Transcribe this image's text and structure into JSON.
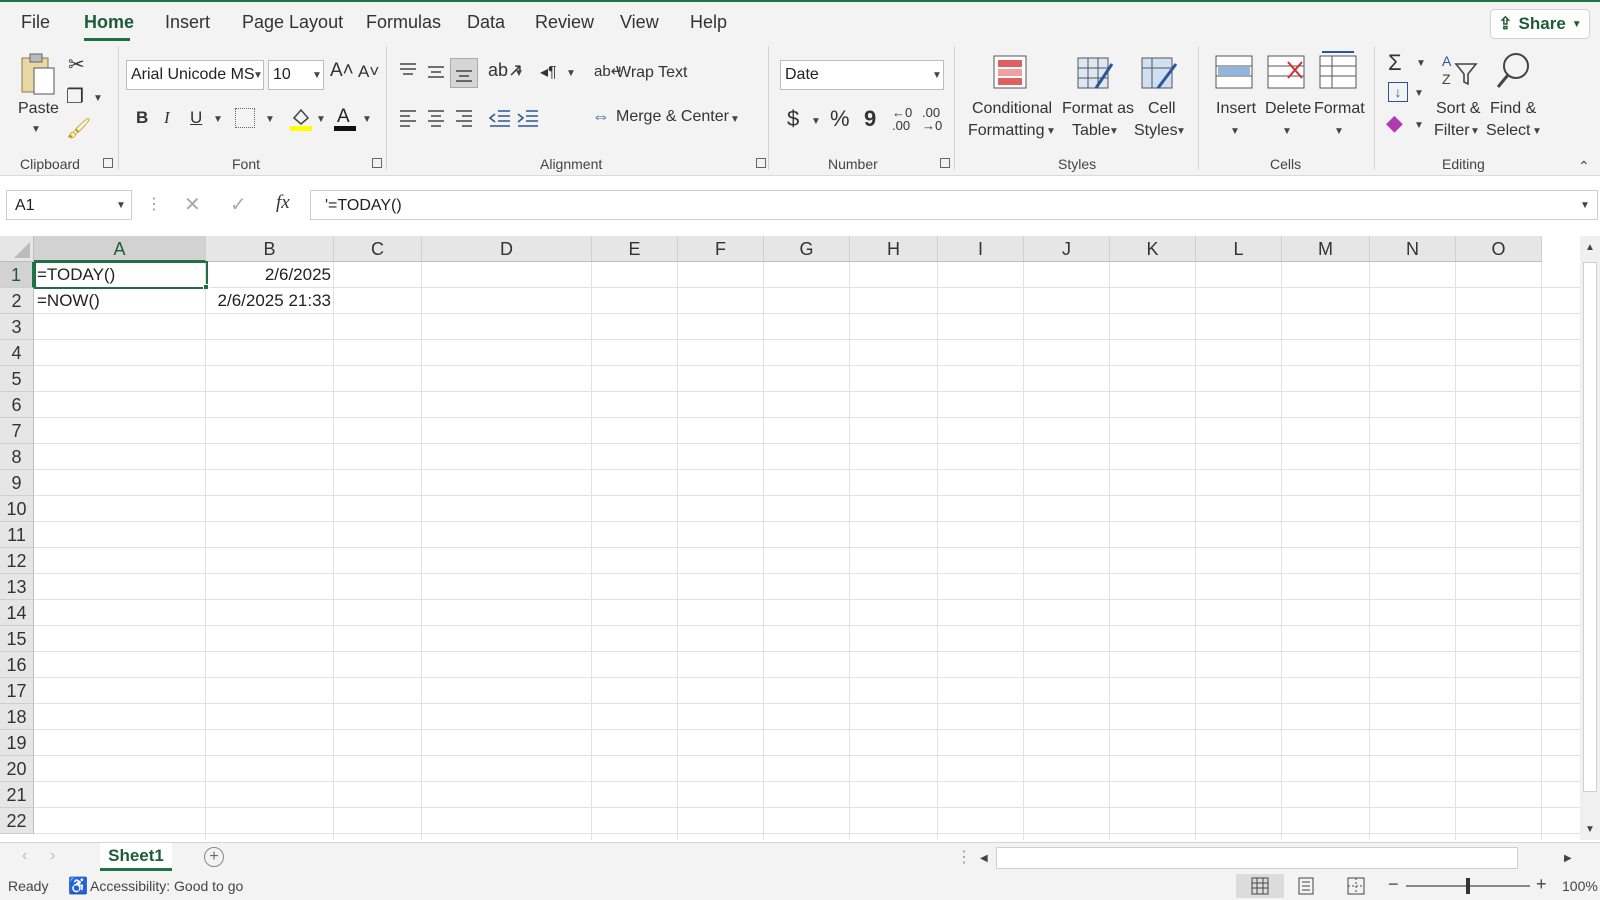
{
  "ribbon_tabs": [
    "File",
    "Home",
    "Insert",
    "Page Layout",
    "Formulas",
    "Data",
    "Review",
    "View",
    "Help"
  ],
  "share_label": "Share",
  "clipboard": {
    "paste": "Paste",
    "group": "Clipboard"
  },
  "font": {
    "name": "Arial Unicode MS",
    "size": "10",
    "group": "Font",
    "bold": "B",
    "italic": "I",
    "underline": "U"
  },
  "alignment": {
    "wrap_text": "Wrap Text",
    "merge_center": "Merge & Center",
    "group": "Alignment"
  },
  "number": {
    "format": "Date",
    "group": "Number",
    "currency": "$",
    "percent": "%",
    "comma": "9"
  },
  "styles": {
    "conditional_1": "Conditional",
    "conditional_2": "Formatting",
    "format_table_1": "Format as",
    "format_table_2": "Table",
    "cell_styles_1": "Cell",
    "cell_styles_2": "Styles",
    "group": "Styles"
  },
  "cells": {
    "insert": "Insert",
    "delete": "Delete",
    "format": "Format",
    "group": "Cells"
  },
  "editing": {
    "sort_1": "Sort &",
    "sort_2": "Filter",
    "find_1": "Find &",
    "find_2": "Select",
    "group": "Editing",
    "sigma": "Σ"
  },
  "formula_bar": {
    "name_box": "A1",
    "fx": "fx",
    "formula": "'=TODAY()"
  },
  "columns": [
    "A",
    "B",
    "C",
    "D",
    "E",
    "F",
    "G",
    "H",
    "I",
    "J",
    "K",
    "L",
    "M",
    "N",
    "O"
  ],
  "rows": [
    "1",
    "2",
    "3",
    "4",
    "5",
    "6",
    "7",
    "8",
    "9",
    "10",
    "11",
    "12",
    "13",
    "14",
    "15",
    "16",
    "17",
    "18",
    "19",
    "20",
    "21",
    "22"
  ],
  "cells_data": {
    "A1": "=TODAY()",
    "B1": "2/6/2025",
    "A2": "=NOW()",
    "B2": "2/6/2025 21:33"
  },
  "sheet_tab": "Sheet1",
  "status": {
    "ready": "Ready",
    "accessibility": "Accessibility: Good to go",
    "zoom": "100%"
  },
  "accent_color": "#217346"
}
